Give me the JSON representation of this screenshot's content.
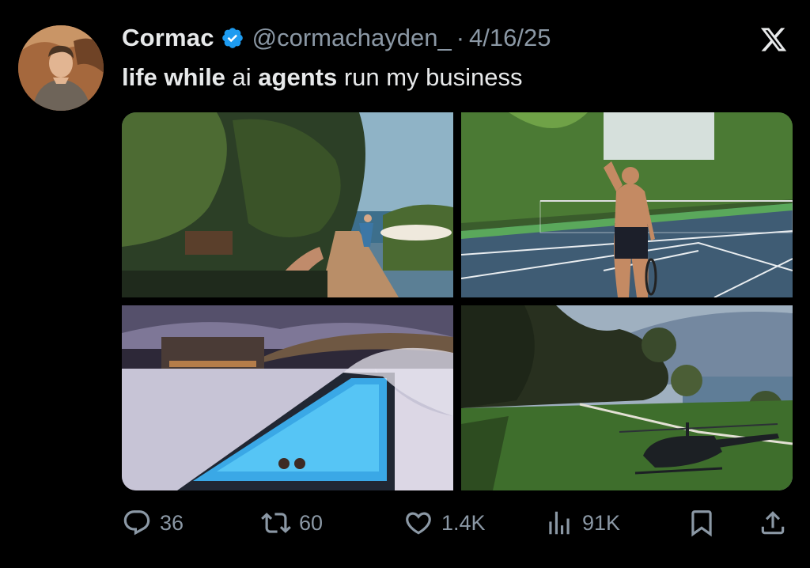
{
  "author": {
    "name": "Cormac",
    "handle": "@cormachayden_",
    "separator": "·",
    "date": "4/16/25",
    "verified": true
  },
  "tweet": {
    "text_bold_1": "life while",
    "text_plain_1": " ai ",
    "text_bold_2": "agents",
    "text_plain_2": " run my business"
  },
  "media": [
    {
      "name": "lakeside-garden-photo"
    },
    {
      "name": "tennis-court-photo"
    },
    {
      "name": "infinity-pool-photo"
    },
    {
      "name": "helicopter-lawn-photo"
    }
  ],
  "actions": {
    "replies": "36",
    "reposts": "60",
    "likes": "1.4K",
    "views": "91K"
  },
  "icons": {
    "platform": "x-logo-icon",
    "reply": "reply-icon",
    "repost": "repost-icon",
    "like": "heart-icon",
    "views": "views-icon",
    "bookmark": "bookmark-icon",
    "share": "share-icon"
  },
  "colors": {
    "background": "#000000",
    "text": "#e7e9ea",
    "muted": "#8b98a5",
    "verified": "#1d9bf0"
  }
}
